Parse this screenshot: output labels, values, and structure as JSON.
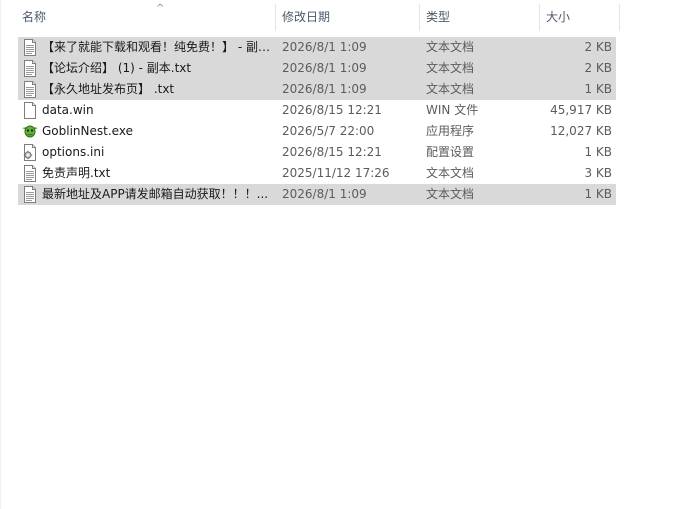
{
  "columns": {
    "name": "名称",
    "date": "修改日期",
    "type": "类型",
    "size": "大小",
    "sort_indicator": "^"
  },
  "files": [
    {
      "name": "【来了就能下载和观看！纯免费！】 - 副…",
      "date": "2026/8/1 1:09",
      "type": "文本文档",
      "size": "2 KB",
      "icon": "text-file-icon",
      "selected": true
    },
    {
      "name": "【论坛介绍】 (1) - 副本.txt",
      "date": "2026/8/1 1:09",
      "type": "文本文档",
      "size": "2 KB",
      "icon": "text-file-icon",
      "selected": true
    },
    {
      "name": "【永久地址发布页】 .txt",
      "date": "2026/8/1 1:09",
      "type": "文本文档",
      "size": "1 KB",
      "icon": "text-file-icon",
      "selected": true
    },
    {
      "name": "data.win",
      "date": "2026/8/15 12:21",
      "type": "WIN 文件",
      "size": "45,917 KB",
      "icon": "blank-file-icon",
      "selected": false
    },
    {
      "name": "GoblinNest.exe",
      "date": "2026/5/7 22:00",
      "type": "应用程序",
      "size": "12,027 KB",
      "icon": "goblin-app-icon",
      "selected": false
    },
    {
      "name": "options.ini",
      "date": "2026/8/15 12:21",
      "type": "配置设置",
      "size": "1 KB",
      "icon": "settings-file-icon",
      "selected": false
    },
    {
      "name": "免责声明.txt",
      "date": "2025/11/12 17:26",
      "type": "文本文档",
      "size": "3 KB",
      "icon": "text-file-icon",
      "selected": false
    },
    {
      "name": "最新地址及APP请发邮箱自动获取！！！...",
      "date": "2026/8/1 1:09",
      "type": "文本文档",
      "size": "1 KB",
      "icon": "text-file-icon",
      "selected": true
    }
  ]
}
